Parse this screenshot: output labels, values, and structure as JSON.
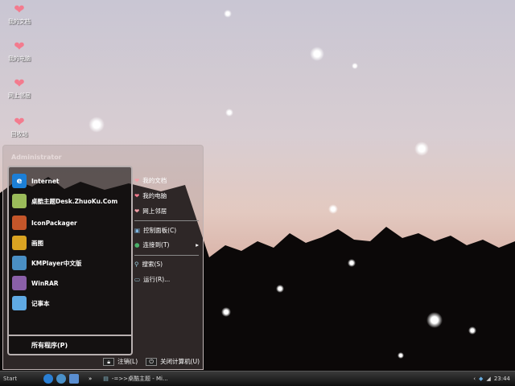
{
  "desktop": {
    "icons": [
      {
        "label": "我的文档"
      },
      {
        "label": "我的电脑"
      },
      {
        "label": "网上邻居"
      },
      {
        "label": "回收站"
      }
    ]
  },
  "start_menu": {
    "user": "Administrator",
    "left_items": [
      {
        "label": "Internet",
        "icon": "ie-icon"
      },
      {
        "label": "桌酷主题Desk.ZhuoKu.Com",
        "icon": "zhuoku-icon"
      },
      {
        "label": "IconPackager",
        "icon": "iconpackager-icon"
      },
      {
        "label": "画图",
        "icon": "paint-icon"
      },
      {
        "label": "KMPlayer中文版",
        "icon": "kmplayer-icon"
      },
      {
        "label": "WinRAR",
        "icon": "winrar-icon"
      },
      {
        "label": "记事本",
        "icon": "notepad-icon"
      }
    ],
    "all_programs": "所有程序(P)",
    "right_items": [
      {
        "label": "我的文档"
      },
      {
        "label": "我的电脑"
      },
      {
        "label": "网上邻居"
      },
      {
        "label": "控制面板(C)"
      },
      {
        "label": "连接到(T)",
        "arrow": "▸"
      },
      {
        "label": "搜索(S)"
      },
      {
        "label": "运行(R)..."
      }
    ],
    "logoff": "注销(L)",
    "shutdown": "关闭计算机(U)"
  },
  "taskbar": {
    "start": "Start",
    "quicklaunch_more": "»",
    "task": "-=>>桌酷主题 - Mi...",
    "clock": "23:44",
    "tray_arrow": "‹"
  }
}
